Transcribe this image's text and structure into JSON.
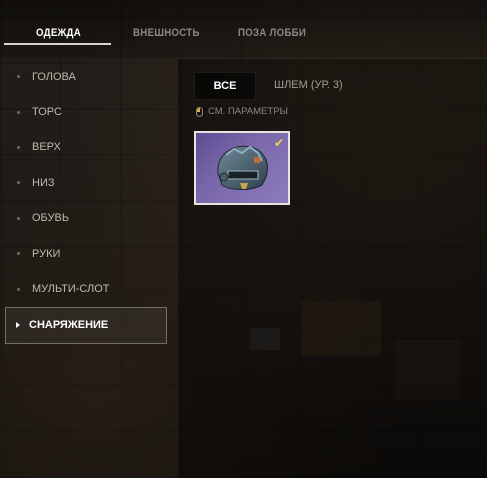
{
  "tabs": [
    {
      "label": "ОДЕЖДА",
      "active": true
    },
    {
      "label": "ВНЕШНОСТЬ",
      "active": false
    },
    {
      "label": "ПОЗА ЛОББИ",
      "active": false
    }
  ],
  "sidebar": {
    "items": [
      {
        "label": "ГОЛОВА"
      },
      {
        "label": "ТОРС"
      },
      {
        "label": "ВЕРХ"
      },
      {
        "label": "НИЗ"
      },
      {
        "label": "ОБУВЬ"
      },
      {
        "label": "РУКИ"
      },
      {
        "label": "МУЛЬТИ-СЛОТ"
      },
      {
        "label": "СНАРЯЖЕНИЕ",
        "active": true
      }
    ]
  },
  "filters": {
    "all_label": "ВСЕ",
    "option_label": "ШЛЕМ (УР. 3)"
  },
  "params_label": "СМ. ПАРАМЕТРЫ",
  "item": {
    "icon": "helmet-level-3-icon",
    "selected": true
  },
  "colors": {
    "accent": "#f0cf5a",
    "card_bg": "#7a67ab"
  }
}
